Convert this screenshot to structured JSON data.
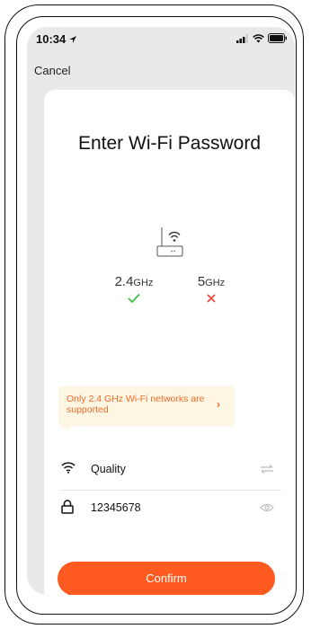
{
  "status_bar": {
    "time": "10:34"
  },
  "nav": {
    "cancel_label": "Cancel"
  },
  "page": {
    "title": "Enter Wi-Fi Password"
  },
  "bands": [
    {
      "label": "2.4",
      "unit": "GHz",
      "supported": true,
      "mark_color": "#3cc24a"
    },
    {
      "label": "5",
      "unit": "GHz",
      "supported": false,
      "mark_color": "#e84c3d"
    }
  ],
  "notice": {
    "text": "Only 2.4 GHz Wi-Fi networks are supported"
  },
  "wifi_field": {
    "value": "Quality"
  },
  "password_field": {
    "value": "12345678"
  },
  "confirm": {
    "label": "Confirm"
  },
  "colors": {
    "accent": "#ff5a1f",
    "notice_bg": "#fdf6e3",
    "notice_text": "#f06a2a"
  }
}
